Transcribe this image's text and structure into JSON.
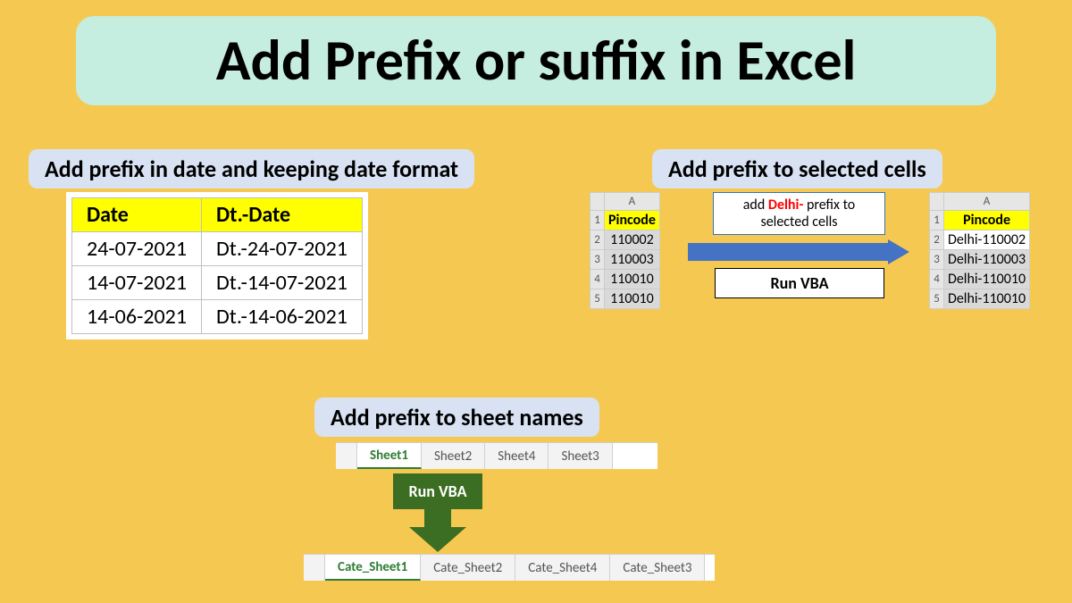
{
  "title": "Add Prefix or suffix in Excel",
  "section1": {
    "label": "Add prefix in date and keeping date format",
    "headers": {
      "col1": "Date",
      "col2": "Dt.-Date"
    },
    "rows": [
      {
        "date": "24-07-2021",
        "prefixed": "Dt.-24-07-2021"
      },
      {
        "date": "14-07-2021",
        "prefixed": "Dt.-14-07-2021"
      },
      {
        "date": "14-06-2021",
        "prefixed": "Dt.-14-06-2021"
      }
    ]
  },
  "section2": {
    "label": "Add prefix to selected cells",
    "col_letter": "A",
    "header_left": "Pincode",
    "header_right": "Pincode",
    "rows_left": [
      "110002",
      "110003",
      "110010",
      "110010"
    ],
    "rows_right": [
      "Delhi-110002",
      "Delhi-110003",
      "Delhi-110010",
      "Delhi-110010"
    ],
    "prefix_note_pre": "add ",
    "prefix_note_highlight": "Delhi-",
    "prefix_note_post": " prefix to selected cells",
    "run_label": "Run VBA"
  },
  "section3": {
    "label": "Add prefix to sheet names",
    "before": [
      "Sheet1",
      "Sheet2",
      "Sheet4",
      "Sheet3"
    ],
    "after": [
      "Cate_Sheet1",
      "Cate_Sheet2",
      "Cate_Sheet4",
      "Cate_Sheet3"
    ],
    "run_label": "Run VBA"
  }
}
